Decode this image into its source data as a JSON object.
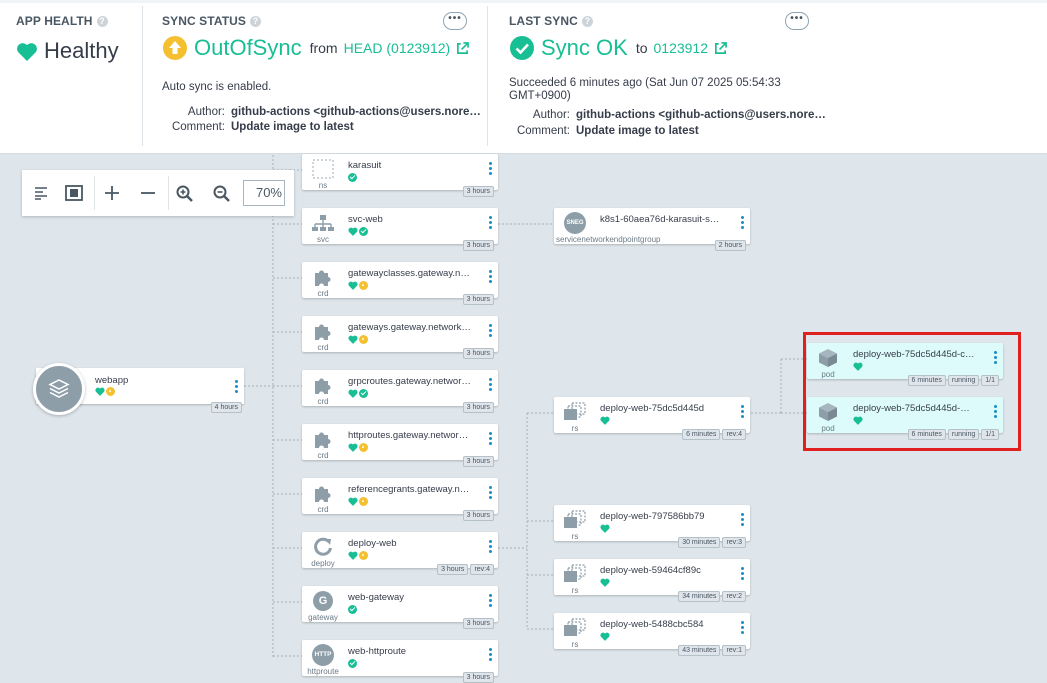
{
  "app_health": {
    "title": "APP HEALTH",
    "status": "Healthy"
  },
  "sync_status": {
    "title": "SYNC STATUS",
    "status": "OutOfSync",
    "from_label": "from",
    "revision": "HEAD (0123912)",
    "auto_sync": "Auto sync is enabled.",
    "author_label": "Author:",
    "author": "github-actions <github-actions@users.nore…",
    "comment_label": "Comment:",
    "comment": "Update image to latest"
  },
  "last_sync": {
    "title": "LAST SYNC",
    "status": "Sync OK",
    "to_label": "to",
    "revision": "0123912",
    "succeeded_line1": "Succeeded 6 minutes ago (Sat Jun 07 2025 05:54:33",
    "succeeded_line2": "GMT+0900)",
    "author_label": "Author:",
    "author": "github-actions <github-actions@users.nore…",
    "comment_label": "Comment:",
    "comment": "Update image to latest"
  },
  "toolbar": {
    "zoom": "70%"
  },
  "app_node": {
    "name": "webapp",
    "age": "4 hours"
  },
  "nodes": [
    {
      "name": "karasuit",
      "kind": "ns",
      "age": "3 hours"
    },
    {
      "name": "svc-web",
      "kind": "svc",
      "age": "3 hours"
    },
    {
      "name": "gatewayclasses.gateway.net…",
      "kind": "crd",
      "age": "3 hours"
    },
    {
      "name": "gateways.gateway.networkin…",
      "kind": "crd",
      "age": "3 hours"
    },
    {
      "name": "grpcroutes.gateway.networki…",
      "kind": "crd",
      "age": "3 hours"
    },
    {
      "name": "httproutes.gateway.networkin…",
      "kind": "crd",
      "age": "3 hours"
    },
    {
      "name": "referencegrants.gateway.net…",
      "kind": "crd",
      "age": "3 hours"
    },
    {
      "name": "deploy-web",
      "kind": "deploy",
      "age": "3 hours",
      "rev": "rev:4"
    },
    {
      "name": "web-gateway",
      "kind": "gateway",
      "age": "3 hours"
    },
    {
      "name": "web-httproute",
      "kind": "httproute",
      "age": "3 hours"
    }
  ],
  "sneg": {
    "name": "k8s1-60aea76d-karasuit-svc-…",
    "kind": "servicenetworkendpointgroup",
    "icon_label": "SNEG",
    "age": "2 hours"
  },
  "replicasets": [
    {
      "name": "deploy-web-75dc5d445d",
      "kind": "rs",
      "age": "6 minutes",
      "rev": "rev:4"
    },
    {
      "name": "deploy-web-797586bb79",
      "kind": "rs",
      "age": "30 minutes",
      "rev": "rev:3"
    },
    {
      "name": "deploy-web-59464cf89c",
      "kind": "rs",
      "age": "34 minutes",
      "rev": "rev:2"
    },
    {
      "name": "deploy-web-5488cbc584",
      "kind": "rs",
      "age": "43 minutes",
      "rev": "rev:1"
    }
  ],
  "pods": [
    {
      "name": "deploy-web-75dc5d445d-cwk…",
      "kind": "pod",
      "age": "6 minutes",
      "state": "running",
      "ready": "1/1"
    },
    {
      "name": "deploy-web-75dc5d445d-m7p…",
      "kind": "pod",
      "age": "6 minutes",
      "state": "running",
      "ready": "1/1"
    }
  ],
  "icons": {
    "gateway_letter": "G",
    "httproute_label": "HTTP"
  },
  "colors": {
    "healthy": "#18be94",
    "out_of_sync": "#f4c030",
    "link": "#18be94",
    "highlight_border": "#e01f1f"
  }
}
